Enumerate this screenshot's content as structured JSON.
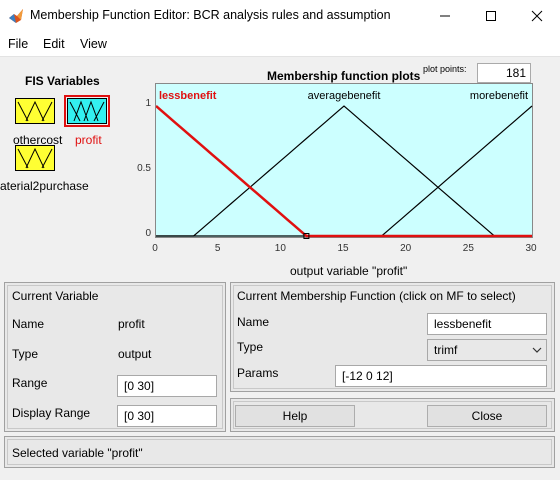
{
  "window": {
    "title": "Membership Function Editor: BCR analysis rules and assumption"
  },
  "menu": [
    "File",
    "Edit",
    "View"
  ],
  "fis_variables": {
    "heading": "FIS Variables",
    "items": [
      {
        "label": "othercost",
        "selected": false
      },
      {
        "label": "profit",
        "selected": true
      },
      {
        "label": "aterial2purchase",
        "selected": false
      }
    ]
  },
  "plot": {
    "title": "Membership function plots",
    "points_label": "plot points:",
    "points_value": "181",
    "xlabel": "output variable \"profit\""
  },
  "chart_data": {
    "type": "line",
    "title": "Membership function plots",
    "xlabel": "output variable \"profit\"",
    "ylabel": "",
    "xlim": [
      0,
      30
    ],
    "ylim": [
      0,
      1
    ],
    "x_ticks": [
      "0",
      "5",
      "10",
      "15",
      "20",
      "25",
      "30"
    ],
    "y_ticks": [
      "0",
      "0.5",
      "1"
    ],
    "series": [
      {
        "name": "lessbenefit",
        "type": "trimf",
        "params": [
          -12,
          0,
          12
        ],
        "selected": true
      },
      {
        "name": "averagebenefit",
        "type": "trimf",
        "params": [
          3,
          15,
          27
        ],
        "selected": false
      },
      {
        "name": "morebenefit",
        "type": "trimf",
        "params": [
          18,
          30,
          42
        ],
        "selected": false
      }
    ],
    "colors": {
      "selected": "#e01010",
      "normal": "#000000",
      "background": "#ccffff"
    }
  },
  "current_variable": {
    "heading": "Current Variable",
    "name_label": "Name",
    "name_value": "profit",
    "type_label": "Type",
    "type_value": "output",
    "range_label": "Range",
    "range_value": "[0 30]",
    "display_range_label": "Display Range",
    "display_range_value": "[0 30]"
  },
  "current_mf": {
    "heading": "Current Membership Function (click on MF to select)",
    "name_label": "Name",
    "name_value": "lessbenefit",
    "type_label": "Type",
    "type_value": "trimf",
    "params_label": "Params",
    "params_value": "[-12 0 12]"
  },
  "buttons": {
    "help": "Help",
    "close": "Close"
  },
  "status": "Selected variable \"profit\""
}
